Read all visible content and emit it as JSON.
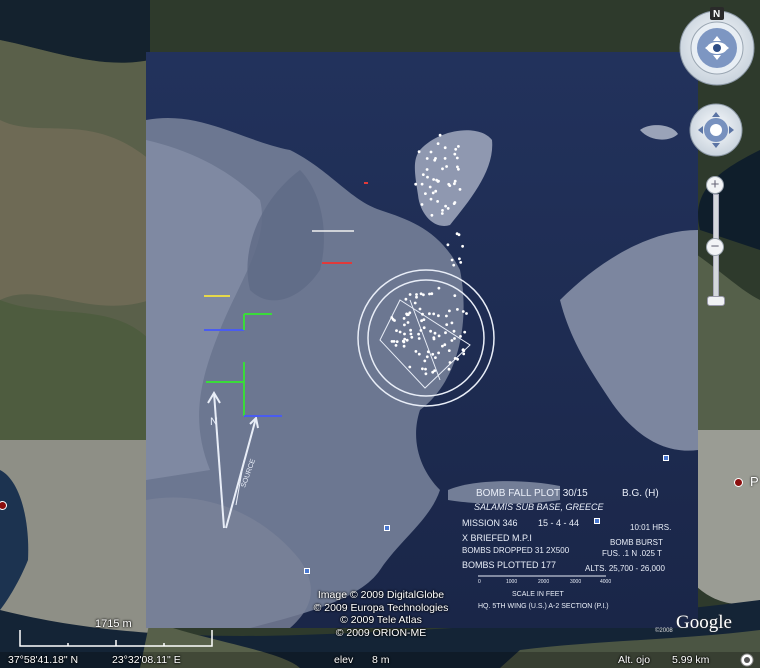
{
  "credits": [
    "Image © 2009 DigitalGlobe",
    "© 2009 Europa Technologies",
    "© 2009 Tele Atlas",
    "© 2009 ORION-ME"
  ],
  "scale": {
    "label": "1715 m"
  },
  "status": {
    "latitude": "37°58'41.18\" N",
    "longitude": "23°32'08.11\" E",
    "elev_label": "elev",
    "elev_value": "8 m",
    "eye_label": "Alt. ojo",
    "eye_value": "5.99 km"
  },
  "brand": {
    "name": "Google",
    "copyright": "©2008"
  },
  "edge_text": "P",
  "nav": {
    "north": "N",
    "zoom_in": "+",
    "zoom_out": "−"
  },
  "overlay": {
    "title": "BOMB FALL PLOT 30/15",
    "unit": "B.G. (H)",
    "target": "SALAMIS SUB BASE, GREECE",
    "mission": "MISSION 346",
    "date": "15 - 4 - 44",
    "time": "10:01 HRS.",
    "mpi_mark": "X BRIEFED M.P.I",
    "burst": "BOMB BURST",
    "dropped": "BOMBS DROPPED 31 2X500",
    "fuse": "FUS. .1 N .025 T",
    "plotted": "BOMBS PLOTTED 177",
    "alts": "ALTS. 25,700 - 26,000",
    "scale_title": "SCALE IN FEET",
    "scale_ticks": [
      "0",
      "1000",
      "2000",
      "3000",
      "4000"
    ],
    "footer": "HQ. 5TH WING (U.S.) A-2 SECTION (P.I.)",
    "north_arrow": "N",
    "axis_label": "SOURCE"
  },
  "colors": {
    "land": "#4e5a45",
    "sea": "#122233",
    "overlay_bg": "#1c2a52",
    "overlay_ink": "#e9eef8",
    "marker_blue": "#4a78d0",
    "marker_red": "#8b0e0e"
  }
}
